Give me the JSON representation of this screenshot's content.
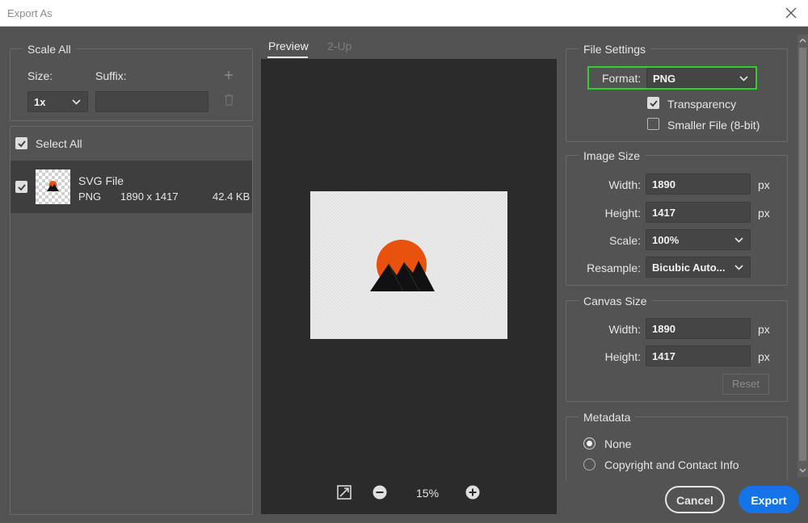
{
  "window": {
    "title": "Export As"
  },
  "scale_all": {
    "legend": "Scale All",
    "size_label": "Size:",
    "suffix_label": "Suffix:",
    "size_value": "1x",
    "suffix_value": ""
  },
  "file_list": {
    "select_all_label": "Select All",
    "items": [
      {
        "name": "SVG File",
        "format": "PNG",
        "dimensions": "1890 x 1417",
        "filesize": "42.4 KB"
      }
    ]
  },
  "preview": {
    "tabs": [
      "Preview",
      "2-Up"
    ],
    "zoom": "15%",
    "artwork": {
      "sun_color": "#e8520e",
      "mountain_color": "#111111"
    }
  },
  "file_settings": {
    "legend": "File Settings",
    "format_label": "Format:",
    "format_value": "PNG",
    "transparency_label": "Transparency",
    "smaller_file_label": "Smaller File (8-bit)",
    "highlight_color": "#33cc33"
  },
  "image_size": {
    "legend": "Image Size",
    "width_label": "Width:",
    "width_value": "1890",
    "height_label": "Height:",
    "height_value": "1417",
    "unit": "px",
    "scale_label": "Scale:",
    "scale_value": "100%",
    "resample_label": "Resample:",
    "resample_value": "Bicubic Auto..."
  },
  "canvas_size": {
    "legend": "Canvas Size",
    "width_label": "Width:",
    "width_value": "1890",
    "height_label": "Height:",
    "height_value": "1417",
    "unit": "px",
    "reset_label": "Reset"
  },
  "metadata": {
    "legend": "Metadata",
    "options": [
      "None",
      "Copyright and Contact Info"
    ]
  },
  "footer": {
    "cancel_label": "Cancel",
    "export_label": "Export",
    "export_color": "#1473e6"
  }
}
